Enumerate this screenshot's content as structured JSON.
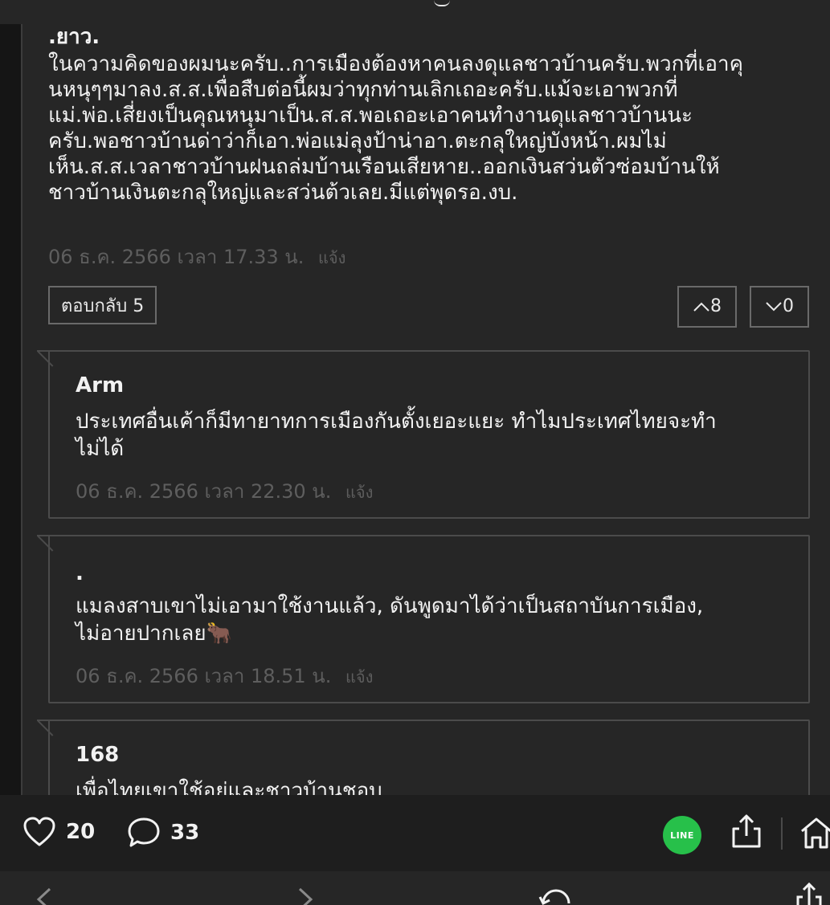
{
  "main_comment": {
    "author": ".ยาว.",
    "lines": [
      "ในความคิดของผมนะครับ..การเมืองต้องหาคนลงดุแลชาวบ้านครับ.พวกที่เอาคุ",
      "นหนุๆๆมาลง.ส.ส.เพื่อสืบต่อนี้ผมว่าทุกท่านเลิกเถอะครับ.แม้จะเอาพวกที่",
      "แม่.พ่อ.เสี่ยงเป็นคุณหนุมาเป็น.ส.ส.พอเถอะเอาคนทำงานดุแลชาวบ้านนะ",
      "ครับ.พอชาวบ้านด่าว่าก็เอา.พ่อแม่ลุงป้าน่าอา.ตะกลุใหญ่บังหน้า.ผมไม่",
      "เห็น.ส.ส.เวลาชาวบ้านฝนถล่มบ้านเรือนเสียหาย..ออกเงินสว่นตัวซ่อมบ้านให้",
      "ชาวบ้านเงินตะกลุใหญ่และสว่นต้วเลย.มีแต่พุดรอ.งบ."
    ],
    "timestamp": "06 ธ.ค. 2566 เวลา 17.33 น.",
    "report_label": "แจ้ง",
    "reply_button": "ตอบกลับ 5",
    "upvotes": "8",
    "downvotes": "0"
  },
  "replies": [
    {
      "author": "Arm",
      "lines": [
        "ประเทศอื่นเค้าก็มีทายาทการเมืองกันตั้งเยอะแยะ ทำไมประเทศไทยจะทำ",
        "ไม่ได้"
      ],
      "timestamp": "06 ธ.ค. 2566 เวลา 22.30 น.",
      "report_label": "แจ้ง"
    },
    {
      "author": ".",
      "lines": [
        "แมลงสาบเขาไม่เอามาใช้งานแล้ว, ดันพูดมาได้ว่าเป็นสถาบันการเมือง,",
        "ไม่อายปากเลย🐂"
      ],
      "timestamp": "06 ธ.ค. 2566 เวลา 18.51 น.",
      "report_label": "แจ้ง"
    },
    {
      "author": "168",
      "lines": [
        "เพื่อไทยเขาใช้อยู่และชาวบ้านชอบ"
      ],
      "timestamp": "",
      "report_label": ""
    }
  ],
  "bottom_bar": {
    "likes": "20",
    "comments": "33",
    "line_label": "LINE"
  },
  "icons": {
    "like": "heart-icon",
    "comment": "speech-bubble-icon",
    "line": "line-app-icon",
    "share": "share-icon",
    "home": "home-icon",
    "upvote": "chevron-up-icon",
    "downvote": "chevron-down-icon"
  },
  "colors": {
    "background": "#262626",
    "line_green": "#27c04a",
    "muted_text": "#5e5e5e"
  }
}
